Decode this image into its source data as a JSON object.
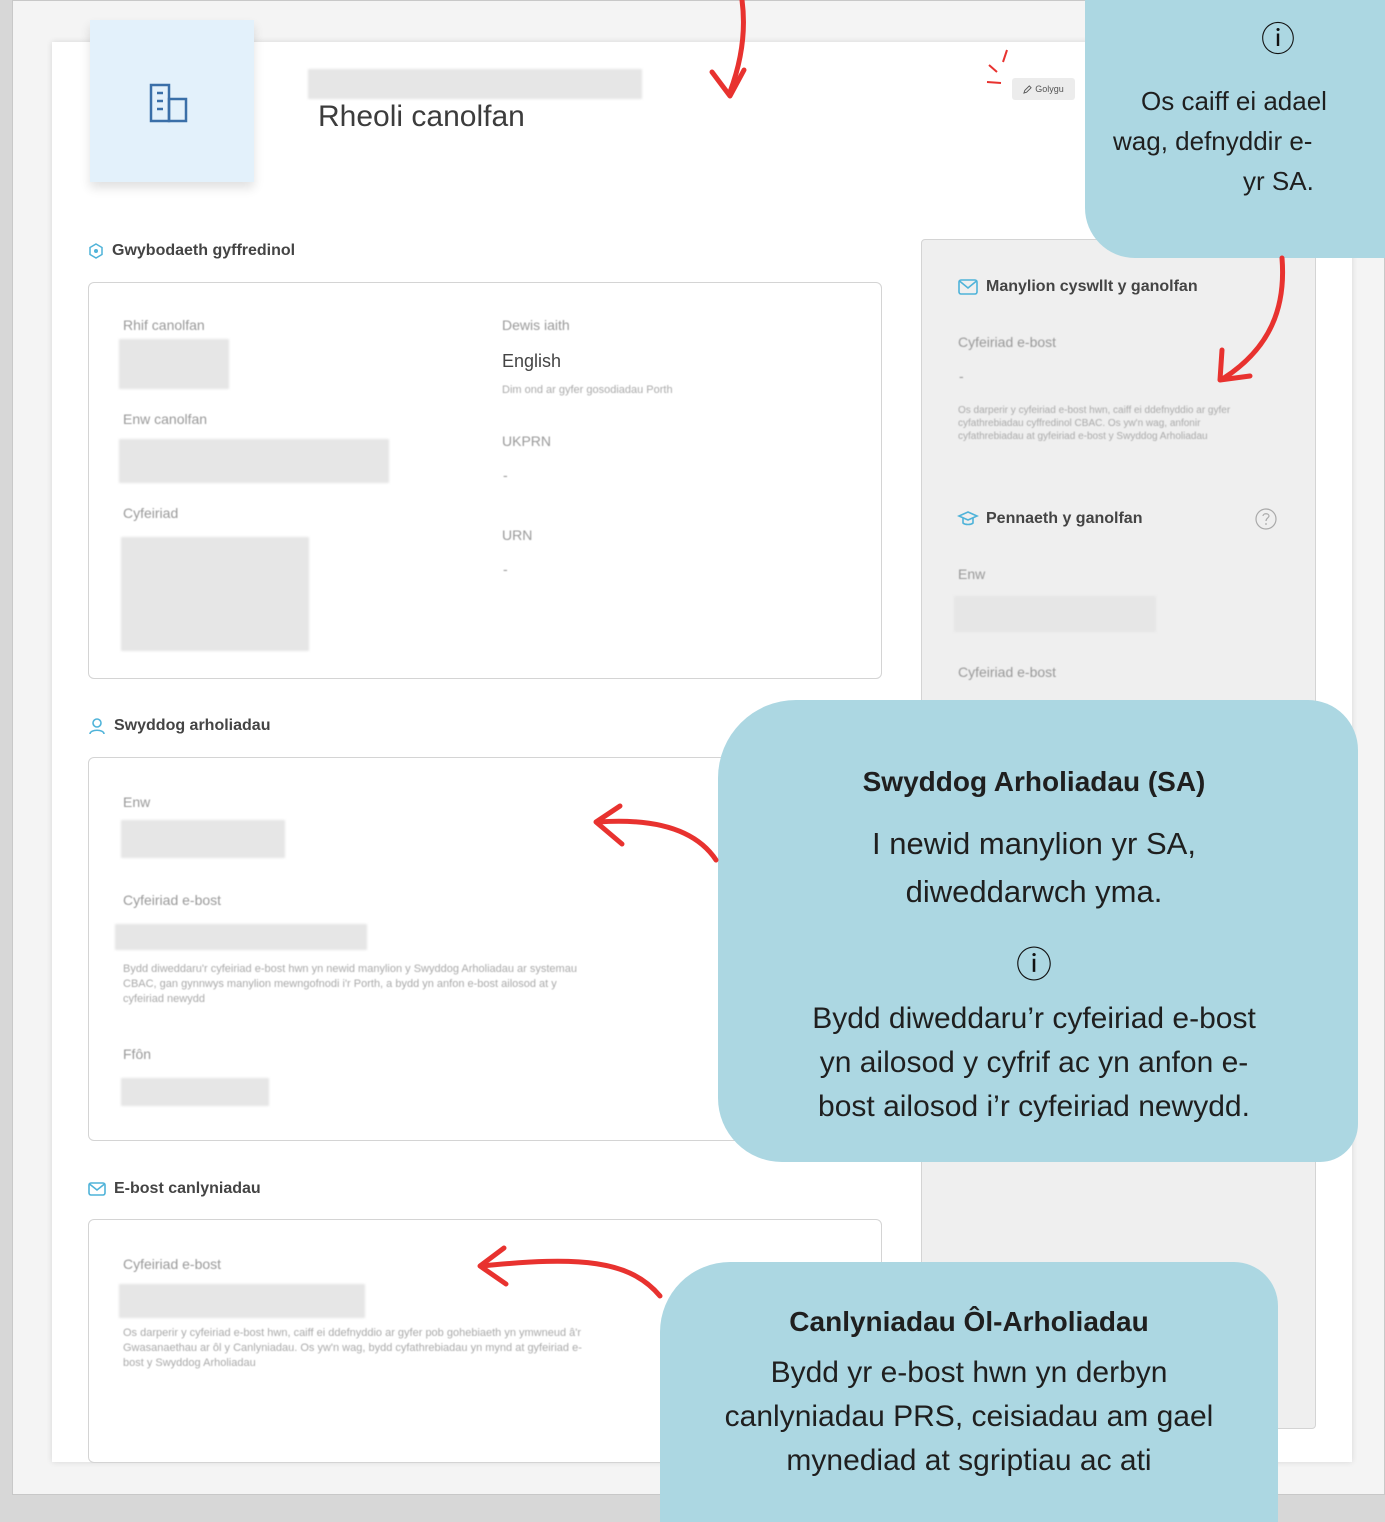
{
  "header": {
    "title": "Rheoli canolfan",
    "edit_label": "Golygu"
  },
  "general": {
    "heading": "Gwybodaeth gyffredinol",
    "centre_number_label": "Rhif canolfan",
    "centre_name_label": "Enw canolfan",
    "address_label": "Cyfeiriad",
    "language_label": "Dewis iaith",
    "language_value": "English",
    "language_hint": "Dim ond ar gyfer gosodiadau Porth",
    "ukprn_label": "UKPRN",
    "ukprn_value": "-",
    "urn_label": "URN",
    "urn_value": "-"
  },
  "exams_officer": {
    "heading": "Swyddog arholiadau",
    "name_label": "Enw",
    "email_label": "Cyfeiriad e-bost",
    "email_hint": "Bydd diweddaru'r cyfeiriad e-bost hwn yn newid manylion y Swyddog Arholiadau ar systemau CBAC, gan gynnwys manylion mewngofnodi i'r Porth, a bydd yn anfon e-bost ailosod at y cyfeiriad newydd",
    "phone_label": "Ffôn"
  },
  "results_email": {
    "heading": "E-bost canlyniadau",
    "email_label": "Cyfeiriad e-bost",
    "email_hint": "Os darperir y cyfeiriad e-bost hwn, caiff ei ddefnyddio ar gyfer pob gohebiaeth yn ymwneud â'r Gwasanaethau ar ôl y Canlyniadau. Os yw'n wag, bydd cyfathrebiadau yn mynd at gyfeiriad e-bost y Swyddog Arholiadau"
  },
  "sidebar": {
    "contact_heading": "Manylion cyswllt y ganolfan",
    "contact_email_label": "Cyfeiriad e-bost",
    "contact_email_value": "-",
    "contact_hint": "Os darperir y cyfeiriad e-bost hwn, caiff ei ddefnyddio ar gyfer cyfathrebiadau cyffredinol CBAC. Os yw'n wag, anfonir cyfathrebiadau at gyfeiriad e-bost y Swyddog Arholiadau",
    "head_heading": "Pennaeth y ganolfan",
    "head_name_label": "Enw",
    "head_email_label": "Cyfeiriad e-bost"
  },
  "callouts": {
    "top": {
      "info_icon": "ⓘ",
      "line1": "Os caiff ei adael",
      "line2": "wag, defnyddir e-",
      "line3": "yr SA."
    },
    "exams_officer": {
      "title": "Swyddog Arholiadau (SA)",
      "line1": "I newid manylion yr SA,",
      "line2": "diweddarwch yma.",
      "info_icon": "ⓘ",
      "line3": "Bydd diweddaru’r cyfeiriad e-bost",
      "line4": "yn ailosod y cyfrif ac yn anfon e-",
      "line5": "bost ailosod i’r cyfeiriad newydd."
    },
    "results": {
      "title": "Canlyniadau Ôl-Arholiadau",
      "line1": "Bydd yr e-bost hwn yn derbyn",
      "line2": "canlyniadau PRS, ceisiadau am gael",
      "line3": "mynediad at sgriptiau ac ati"
    }
  },
  "colors": {
    "bubble": "#acd7e2",
    "arrow": "#e8322f",
    "accent": "#4fb3d9"
  }
}
